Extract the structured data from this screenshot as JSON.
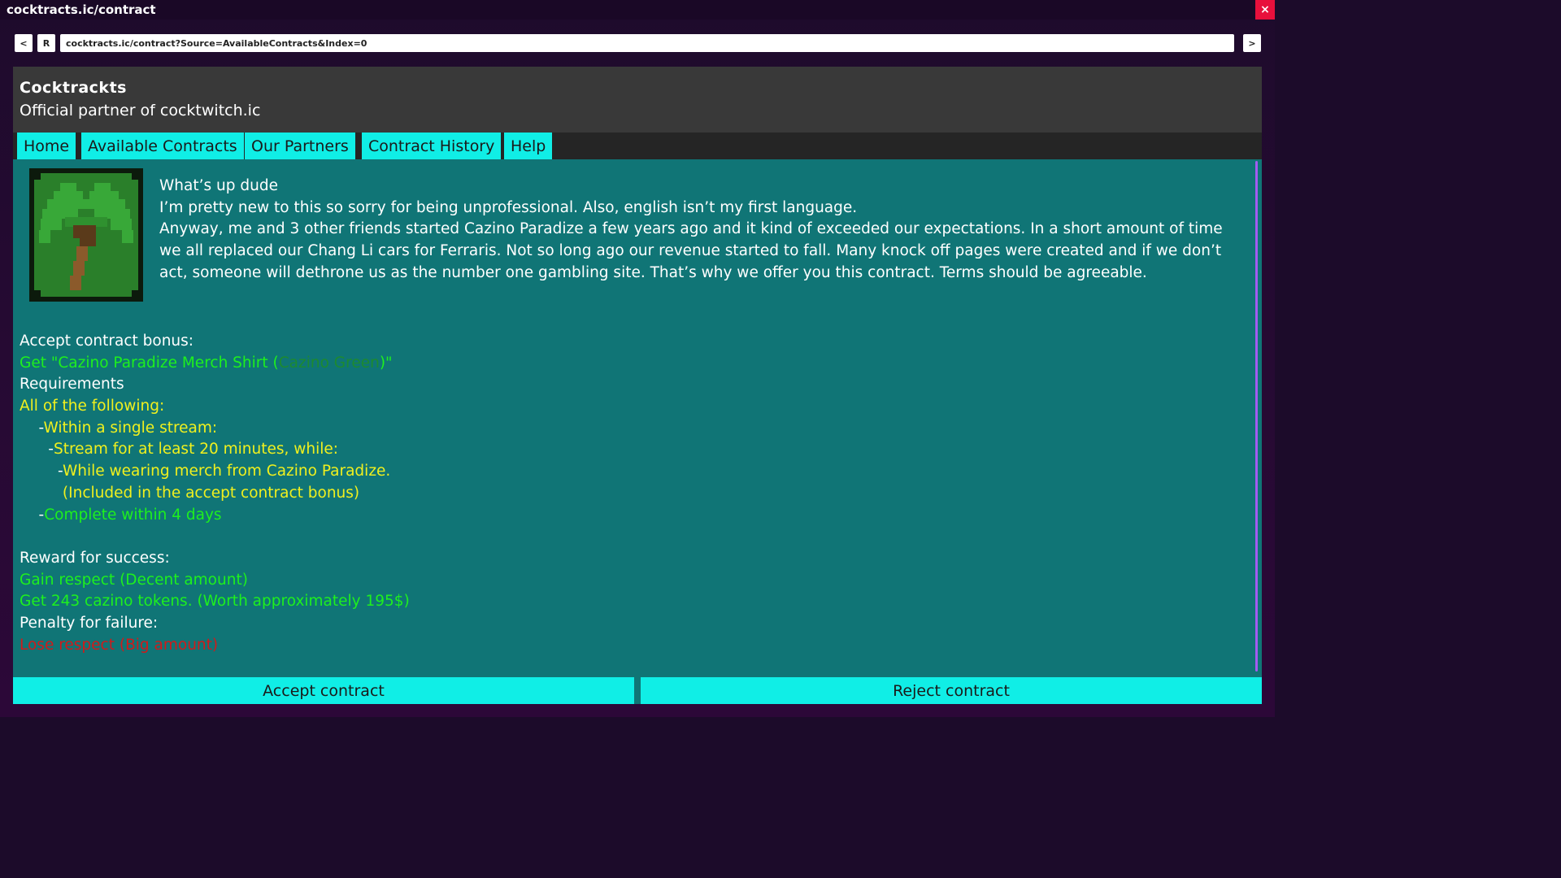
{
  "window": {
    "title": "cocktracts.ic/contract",
    "close_label": "×"
  },
  "browser": {
    "back_label": "<",
    "reload_label": "R",
    "forward_label": ">",
    "url": "cocktracts.ic/contract?Source=AvailableContracts&Index=0"
  },
  "site": {
    "title": "Cocktrackts",
    "subtitle": "Official partner of cocktwitch.ic"
  },
  "nav": {
    "items": [
      {
        "label": "Home"
      },
      {
        "label": "Available Contracts"
      },
      {
        "label": "Our Partners"
      },
      {
        "label": "Contract History"
      },
      {
        "label": "Help"
      }
    ]
  },
  "contract": {
    "avatar_icon": "palm-tree-icon",
    "intro": [
      "What’s up dude",
      "I’m pretty new to this so sorry for being unprofessional. Also, english isn’t my first language.",
      "Anyway, me and 3 other friends started Cazino Paradize a few years ago and it kind of exceeded our expectations. In a short amount of time we all replaced our Chang Li cars for Ferraris. Not so long ago our revenue started to fall. Many knock off pages were created and if we don’t act, someone will dethrone us as the number one gambling site. That’s why we offer you this contract. Terms should be agreeable."
    ],
    "bonus_heading": "Accept contract bonus:",
    "bonus_prefix": "Get \"Cazino Paradize Merch Shirt (",
    "bonus_color_name": "Cazino Green",
    "bonus_suffix": ")\"",
    "requirements_heading": "Requirements",
    "requirements": {
      "all_label": "All of the following:",
      "single_stream_dash": "    -",
      "single_stream": "Within a single stream:",
      "stream_dash": "      -",
      "stream": "Stream for at least 20 minutes, while:",
      "merch_dash": "        -",
      "merch": "While wearing merch from Cazino Paradize.",
      "merch_note": "         (Included in the accept contract bonus)",
      "complete_dash": "    -",
      "complete": "Complete within 4 days"
    },
    "reward_heading": "Reward for success:",
    "rewards": [
      "Gain respect (Decent amount)",
      "Get 243 cazino tokens. (Worth approximately 195$)"
    ],
    "penalty_heading": "Penalty for failure:",
    "penalties": [
      "Lose respect (Big amount)"
    ]
  },
  "actions": {
    "accept_label": "Accept contract",
    "reject_label": "Reject contract"
  },
  "colors": {
    "accent_cyan": "#10eee6",
    "page_teal": "#107576",
    "success_green": "#1ef01e",
    "requirement_yellow": "#f0f01e",
    "penalty_red": "#d11a1a",
    "close_red": "#e8103c"
  }
}
